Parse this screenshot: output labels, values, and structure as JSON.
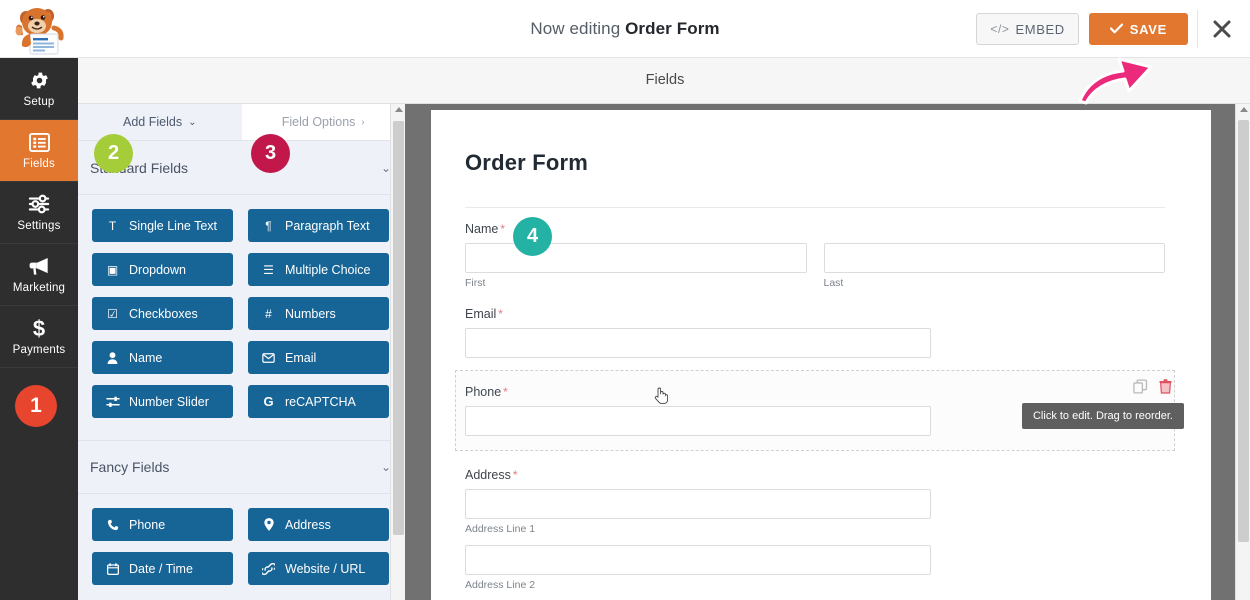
{
  "topbar": {
    "editing_prefix": "Now editing",
    "form_name": "Order Form",
    "embed_label": "EMBED",
    "embed_icon": "code-icon",
    "save_label": "SAVE",
    "save_icon": "check-icon",
    "close_icon": "close-icon",
    "logo_icon": "wpforms-mascot-logo"
  },
  "subheader": {
    "title": "Fields"
  },
  "sidebar": {
    "items": [
      {
        "label": "Setup",
        "icon": "gear-icon",
        "active": false
      },
      {
        "label": "Fields",
        "icon": "list-icon",
        "active": true
      },
      {
        "label": "Settings",
        "icon": "sliders-icon",
        "active": false
      },
      {
        "label": "Marketing",
        "icon": "megaphone-icon",
        "active": false
      },
      {
        "label": "Payments",
        "icon": "dollar-icon",
        "active": false
      }
    ]
  },
  "panel": {
    "tabs": [
      {
        "label": "Add Fields",
        "caret": "⌄",
        "active": true
      },
      {
        "label": "Field Options",
        "caret": "›",
        "active": false
      }
    ],
    "sections": [
      {
        "title": "Standard Fields",
        "caret": "⌄",
        "fields": [
          {
            "label": "Single Line Text",
            "icon": "text-icon",
            "glyph": "T"
          },
          {
            "label": "Paragraph Text",
            "icon": "paragraph-icon",
            "glyph": "¶"
          },
          {
            "label": "Dropdown",
            "icon": "dropdown-icon",
            "glyph": "▣"
          },
          {
            "label": "Multiple Choice",
            "icon": "radio-list-icon",
            "glyph": "☰"
          },
          {
            "label": "Checkboxes",
            "icon": "checkbox-icon",
            "glyph": "☑"
          },
          {
            "label": "Numbers",
            "icon": "hash-icon",
            "glyph": "#"
          },
          {
            "label": "Name",
            "icon": "user-icon",
            "glyph": "♟"
          },
          {
            "label": "Email",
            "icon": "envelope-icon",
            "glyph": "✉"
          },
          {
            "label": "Number Slider",
            "icon": "slider-icon",
            "glyph": "≡"
          },
          {
            "label": "reCAPTCHA",
            "icon": "google-g-icon",
            "glyph": "G"
          }
        ]
      },
      {
        "title": "Fancy Fields",
        "caret": "⌄",
        "fields": [
          {
            "label": "Phone",
            "icon": "phone-icon",
            "glyph": "☎"
          },
          {
            "label": "Address",
            "icon": "map-pin-icon",
            "glyph": "⚑"
          },
          {
            "label": "Date / Time",
            "icon": "calendar-icon",
            "glyph": "☷"
          },
          {
            "label": "Website / URL",
            "icon": "link-icon",
            "glyph": "⚭"
          }
        ]
      }
    ]
  },
  "preview": {
    "form_title": "Order Form",
    "fields": [
      {
        "label": "Name",
        "required": "*",
        "type": "name",
        "sub": [
          {
            "placeholder": "",
            "sublabel": "First"
          },
          {
            "placeholder": "",
            "sublabel": "Last"
          }
        ]
      },
      {
        "label": "Email",
        "required": "*",
        "type": "single",
        "sublabel": ""
      },
      {
        "label": "Phone",
        "required": "*",
        "type": "single",
        "sublabel": "",
        "hovered": true
      },
      {
        "label": "Address",
        "required": "*",
        "type": "address",
        "sub": [
          {
            "sublabel": "Address Line 1"
          },
          {
            "sublabel": "Address Line 2"
          }
        ]
      }
    ],
    "tooltip": "Click to edit. Drag to reorder.",
    "tools": {
      "duplicate_icon": "duplicate-icon",
      "delete_icon": "trash-icon"
    }
  },
  "badges": [
    {
      "number": "1",
      "color": "#e8452f"
    },
    {
      "number": "2",
      "color": "#a5cd39"
    },
    {
      "number": "3",
      "color": "#c2174b"
    },
    {
      "number": "4",
      "color": "#24b2a4"
    }
  ],
  "annotation": {
    "arrow_icon": "pink-arrow-pointing-to-save",
    "arrow_color": "#ec2a7b"
  },
  "colors": {
    "accent_orange": "#e27730",
    "field_blue": "#176496",
    "nav_dark": "#2e2e2e",
    "panel_bg": "#eef1f8",
    "preview_backdrop": "#717171"
  }
}
